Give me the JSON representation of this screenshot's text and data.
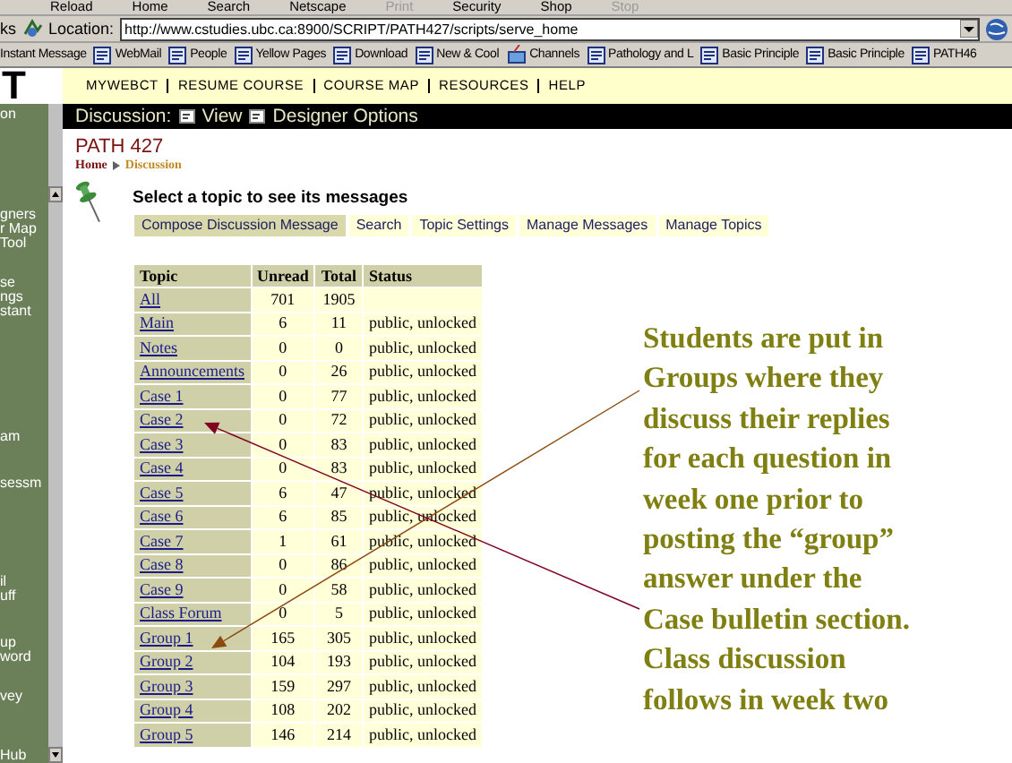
{
  "browser": {
    "menu": [
      {
        "label": "Reload",
        "disabled": false
      },
      {
        "label": "Home",
        "disabled": false
      },
      {
        "label": "Search",
        "disabled": false
      },
      {
        "label": "Netscape",
        "disabled": false
      },
      {
        "label": "Print",
        "disabled": true
      },
      {
        "label": "Security",
        "disabled": false
      },
      {
        "label": "Shop",
        "disabled": false
      },
      {
        "label": "Stop",
        "disabled": true
      }
    ],
    "location": {
      "edge_text": "ks",
      "label": "Location:",
      "url": "http://www.cstudies.ubc.ca:8900/SCRIPT/PATH427/scripts/serve_home"
    },
    "bookmarks": [
      {
        "label": "Instant Message",
        "kind": "plain"
      },
      {
        "label": "WebMail",
        "kind": "page"
      },
      {
        "label": "People",
        "kind": "page"
      },
      {
        "label": "Yellow Pages",
        "kind": "page"
      },
      {
        "label": "Download",
        "kind": "page"
      },
      {
        "label": "New & Cool",
        "kind": "page"
      },
      {
        "label": "Channels",
        "kind": "channel"
      },
      {
        "label": "Pathology and L",
        "kind": "page"
      },
      {
        "label": "Basic Principle",
        "kind": "page"
      },
      {
        "label": "Basic Principle",
        "kind": "page"
      },
      {
        "label": "PATH46",
        "kind": "page"
      }
    ]
  },
  "header": {
    "logo": "T",
    "nav": [
      "MYWEBCT",
      "RESUME COURSE",
      "COURSE MAP",
      "RESOURCES",
      "HELP"
    ]
  },
  "sidebar": {
    "items": [
      {
        "lines": [
          "on"
        ]
      },
      {
        "lines": [
          "gners",
          "r Map",
          "Tool"
        ]
      },
      {
        "lines": [
          "se",
          "ngs",
          "stant"
        ]
      },
      {
        "lines": [
          "am"
        ]
      },
      {
        "lines": [
          "sessm"
        ]
      },
      {
        "lines": [
          "il",
          "uff"
        ]
      },
      {
        "lines": [
          "up",
          "word"
        ]
      },
      {
        "lines": [
          "vey"
        ]
      },
      {
        "lines": [
          "Hub"
        ]
      }
    ]
  },
  "main": {
    "section": "Discussion:",
    "view_options": [
      "View",
      "Designer Options"
    ],
    "course": "PATH 427",
    "breadcrumb": [
      "Home",
      "Discussion"
    ],
    "heading": "Select a topic to see its messages",
    "actions": [
      {
        "label": "Compose Discussion Message",
        "selected": true
      },
      {
        "label": "Search",
        "selected": false
      },
      {
        "label": "Topic Settings",
        "selected": false
      },
      {
        "label": "Manage Messages",
        "selected": false
      },
      {
        "label": "Manage Topics",
        "selected": false
      }
    ],
    "table": {
      "columns": [
        "Topic",
        "Unread",
        "Total",
        "Status"
      ],
      "rows": [
        {
          "topic": "All",
          "unread": "701",
          "total": "1905"
        },
        {
          "topic": "Main",
          "unread": "6",
          "total": "11",
          "status": "public, unlocked"
        },
        {
          "topic": "Notes",
          "unread": "0",
          "total": "0",
          "status": "public, unlocked"
        },
        {
          "topic": "Announcements",
          "unread": "0",
          "total": "26",
          "status": "public, unlocked"
        },
        {
          "topic": "Case 1",
          "unread": "0",
          "total": "77",
          "status": "public, unlocked"
        },
        {
          "topic": "Case 2",
          "unread": "0",
          "total": "72",
          "status": "public, unlocked"
        },
        {
          "topic": "Case 3",
          "unread": "0",
          "total": "83",
          "status": "public, unlocked"
        },
        {
          "topic": "Case 4",
          "unread": "0",
          "total": "83",
          "status": "public, unlocked"
        },
        {
          "topic": "Case 5",
          "unread": "6",
          "total": "47",
          "status": "public, unlocked"
        },
        {
          "topic": "Case 6",
          "unread": "6",
          "total": "85",
          "status": "public, unlocked"
        },
        {
          "topic": "Case 7",
          "unread": "1",
          "total": "61",
          "status": "public, unlocked"
        },
        {
          "topic": "Case 8",
          "unread": "0",
          "total": "86",
          "status": "public, unlocked"
        },
        {
          "topic": "Case 9",
          "unread": "0",
          "total": "58",
          "status": "public, unlocked"
        },
        {
          "topic": "Class Forum",
          "unread": "0",
          "total": "5",
          "status": "public, unlocked"
        },
        {
          "topic": "Group 1",
          "unread": "165",
          "total": "305",
          "status": "public, unlocked"
        },
        {
          "topic": "Group 2",
          "unread": "104",
          "total": "193",
          "status": "public, unlocked"
        },
        {
          "topic": "Group 3",
          "unread": "159",
          "total": "297",
          "status": "public, unlocked"
        },
        {
          "topic": "Group 4",
          "unread": "108",
          "total": "202",
          "status": "public, unlocked"
        },
        {
          "topic": "Group 5",
          "unread": "146",
          "total": "214",
          "status": "public, unlocked"
        }
      ]
    }
  },
  "annotation": {
    "lines": [
      "Students are put in",
      "Groups where they",
      "discuss their replies",
      "for each question in",
      "week one prior to",
      "posting the “group”",
      "answer under the",
      "Case bulletin section.",
      "Class discussion",
      "follows in week two"
    ]
  }
}
